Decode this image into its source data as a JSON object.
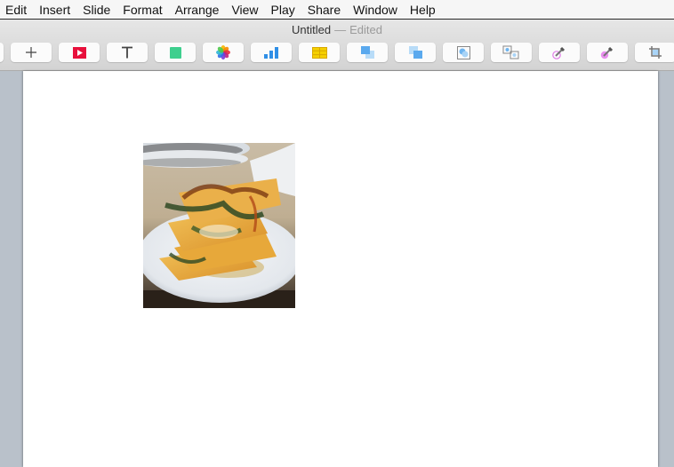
{
  "menubar": {
    "items": [
      "Edit",
      "Insert",
      "Slide",
      "Format",
      "Arrange",
      "View",
      "Play",
      "Share",
      "Window",
      "Help"
    ]
  },
  "window": {
    "title": "Untitled",
    "separator": "—",
    "status": "Edited"
  },
  "toolbar": {
    "buttons": [
      {
        "name": "partial-button",
        "icon": "none"
      },
      {
        "name": "add-slide-button",
        "icon": "plus-icon"
      },
      {
        "name": "play-button",
        "icon": "play-icon"
      },
      {
        "name": "text-button",
        "icon": "text-icon"
      },
      {
        "name": "shape-button",
        "icon": "shape-square-icon"
      },
      {
        "name": "media-button",
        "icon": "photos-icon"
      },
      {
        "name": "chart-button",
        "icon": "bar-chart-icon"
      },
      {
        "name": "table-button",
        "icon": "table-icon"
      },
      {
        "name": "bring-to-front-button",
        "icon": "bring-front-icon"
      },
      {
        "name": "send-to-back-button",
        "icon": "send-back-icon"
      },
      {
        "name": "group-button",
        "icon": "group-icon"
      },
      {
        "name": "ungroup-button",
        "icon": "ungroup-icon"
      },
      {
        "name": "instant-alpha-button",
        "icon": "eyedropper-outline-icon"
      },
      {
        "name": "color-picker-button",
        "icon": "eyedropper-filled-icon"
      },
      {
        "name": "crop-button",
        "icon": "crop-icon"
      }
    ],
    "colors": {
      "play": "#e8103c",
      "shape": "#3ecf8e",
      "chart": "#2f8fe6",
      "table": "#f5d000",
      "arrange": "#7fbdf0",
      "eyedropper": "#e07de6"
    }
  },
  "slide": {
    "image": {
      "alt": "Plated layered pasta dish with greens"
    }
  }
}
